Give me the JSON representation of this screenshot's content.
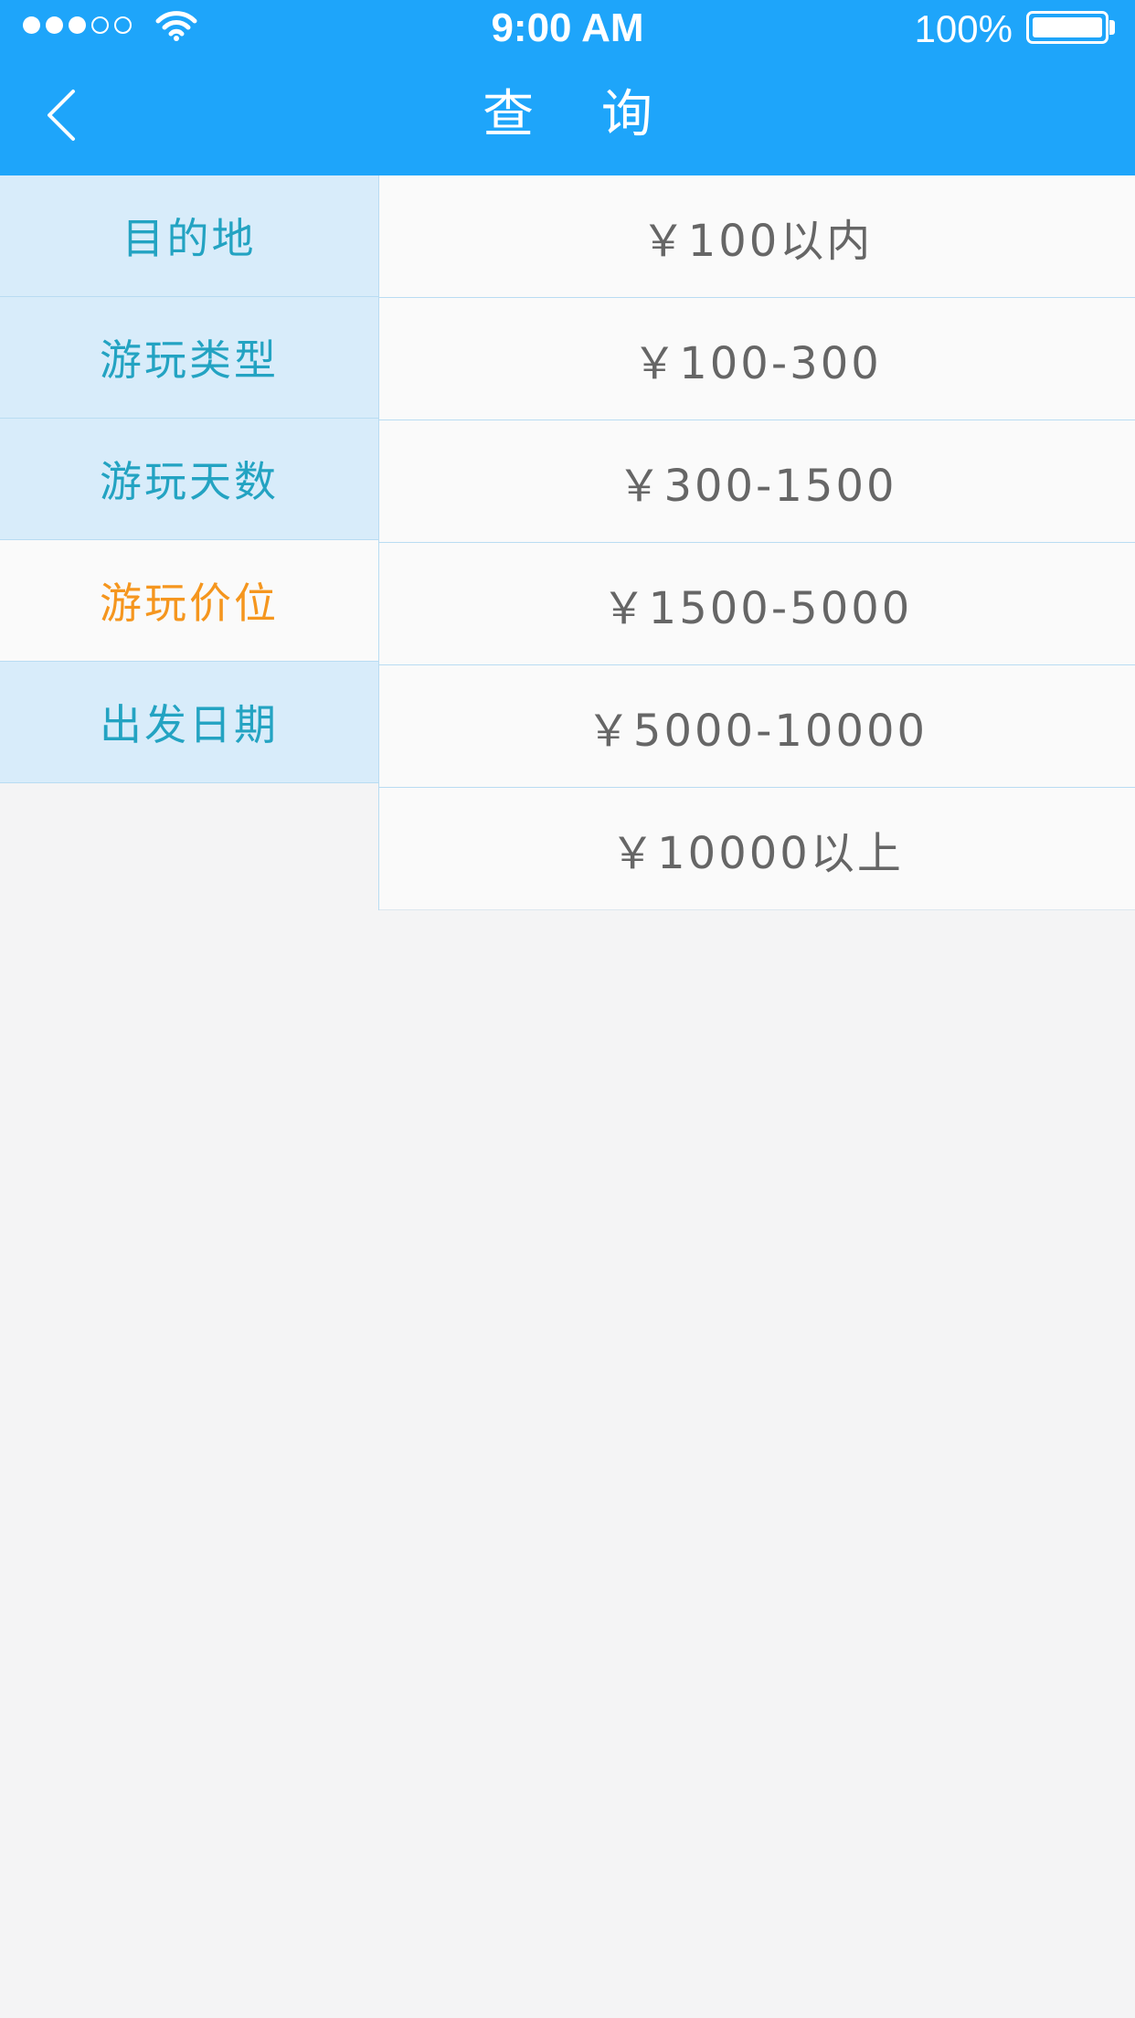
{
  "status_bar": {
    "time": "9:00 AM",
    "battery_percent": "100%",
    "signal_strength": 3,
    "signal_total": 5,
    "wifi_icon": "wifi-icon",
    "battery_icon": "battery-icon"
  },
  "header": {
    "title": "查 询",
    "back_icon": "chevron-left-icon",
    "background_color": "#1ea5fa"
  },
  "categories": [
    {
      "label": "目的地",
      "active": false
    },
    {
      "label": "游玩类型",
      "active": false
    },
    {
      "label": "游玩天数",
      "active": false
    },
    {
      "label": "游玩价位",
      "active": true
    },
    {
      "label": "出发日期",
      "active": false
    }
  ],
  "price_options": [
    {
      "label": "￥100以内"
    },
    {
      "label": "￥100-300"
    },
    {
      "label": "￥300-1500"
    },
    {
      "label": "￥1500-5000"
    },
    {
      "label": "￥5000-10000"
    },
    {
      "label": "￥10000以上"
    }
  ],
  "colors": {
    "accent": "#1ea5fa",
    "category_text": "#23a3c2",
    "category_active_text": "#f5961e",
    "option_text": "#666666"
  }
}
